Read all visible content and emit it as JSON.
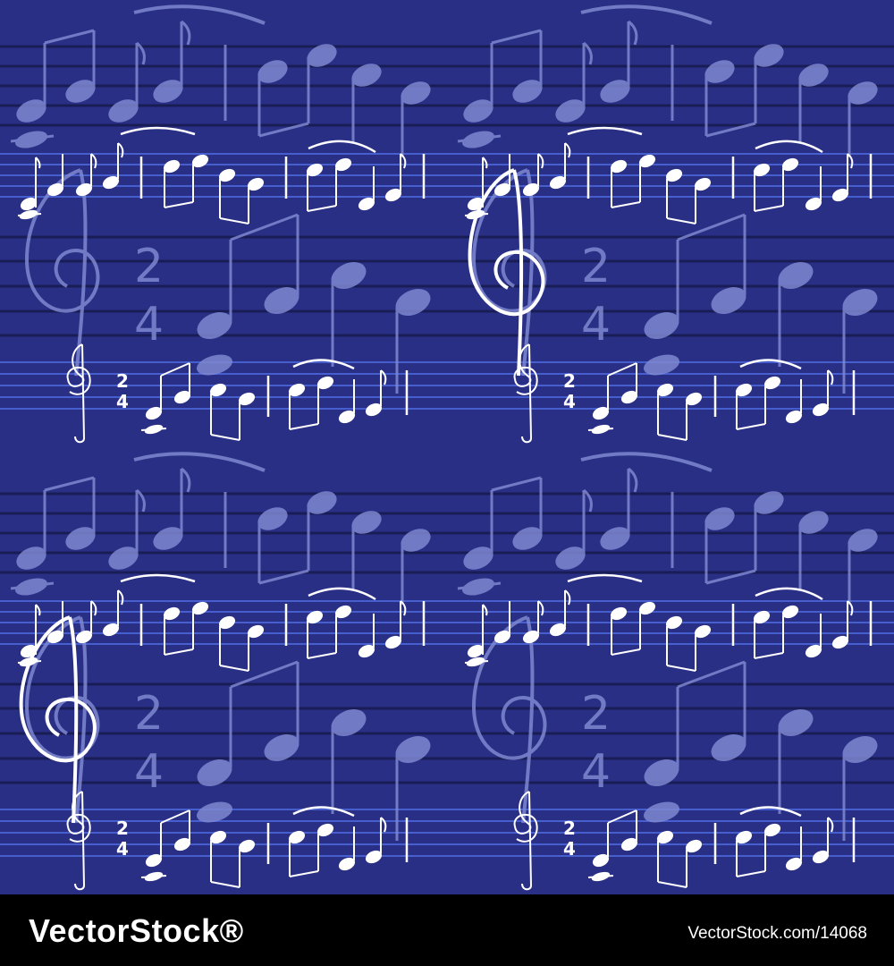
{
  "colors": {
    "background": "#2a2f86",
    "staff_line_dark": "#171a4d",
    "staff_line_light": "#4b64d8",
    "note_faint": "#7f88d0",
    "note_bright": "#ffffff",
    "footer_background": "#000000",
    "footer_text": "#ffffff"
  },
  "artwork": {
    "pattern": "seamless sheet music on blue",
    "time_signature": {
      "top": "2",
      "bottom": "4"
    }
  },
  "footer": {
    "logo_text": "VectorStock®",
    "url_text": "VectorStock.com/14068"
  }
}
